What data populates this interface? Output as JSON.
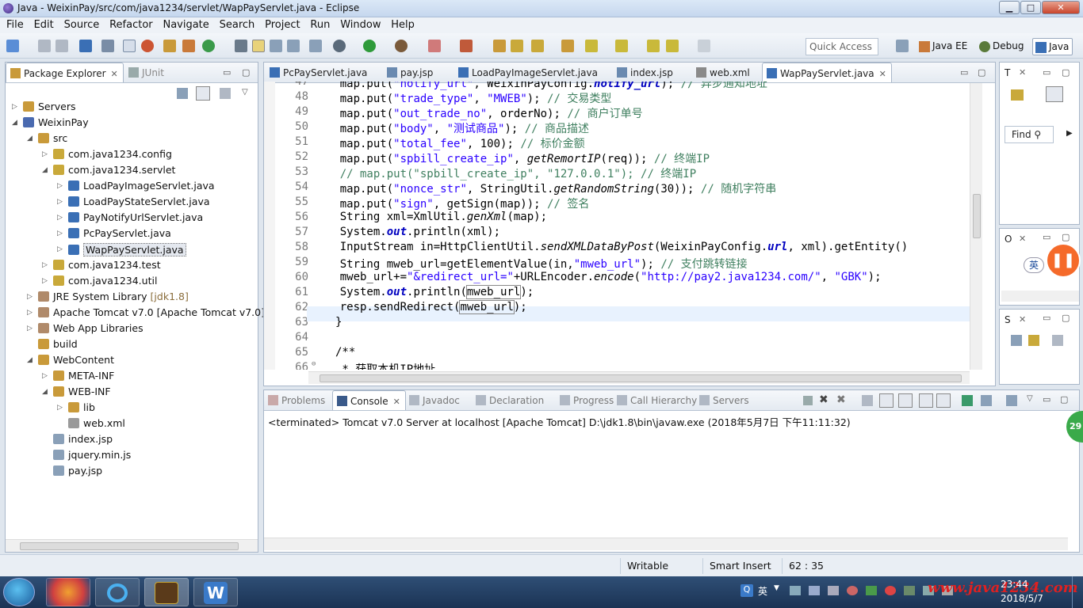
{
  "window": {
    "title": "Java - WeixinPay/src/com/java1234/servlet/WapPayServlet.java - Eclipse",
    "min": "▁",
    "max": "□",
    "close": "✕"
  },
  "menu": [
    "File",
    "Edit",
    "Source",
    "Refactor",
    "Navigate",
    "Search",
    "Project",
    "Run",
    "Window",
    "Help"
  ],
  "toolbar": {
    "quick_access_placeholder": "Quick Access",
    "perspectives": [
      "Java EE",
      "Debug",
      "Java"
    ]
  },
  "package_explorer": {
    "tabs": [
      "Package Explorer",
      "JUnit"
    ],
    "items": [
      {
        "label": "Servers",
        "depth": 0,
        "arrow": "▷"
      },
      {
        "label": "WeixinPay",
        "depth": 0,
        "arrow": "◢"
      },
      {
        "label": "src",
        "depth": 1,
        "arrow": "◢"
      },
      {
        "label": "com.java1234.config",
        "depth": 2,
        "arrow": "▷"
      },
      {
        "label": "com.java1234.servlet",
        "depth": 2,
        "arrow": "◢"
      },
      {
        "label": "LoadPayImageServlet.java",
        "depth": 3,
        "arrow": "▷"
      },
      {
        "label": "LoadPayStateServlet.java",
        "depth": 3,
        "arrow": "▷"
      },
      {
        "label": "PayNotifyUrlServlet.java",
        "depth": 3,
        "arrow": "▷"
      },
      {
        "label": "PcPayServlet.java",
        "depth": 3,
        "arrow": "▷"
      },
      {
        "label": "WapPayServlet.java",
        "depth": 3,
        "arrow": "▷"
      },
      {
        "label": "com.java1234.test",
        "depth": 2,
        "arrow": "▷"
      },
      {
        "label": "com.java1234.util",
        "depth": 2,
        "arrow": "▷"
      },
      {
        "label": "JRE System Library",
        "sub": "[jdk1.8]",
        "depth": 1,
        "arrow": "▷"
      },
      {
        "label": "Apache Tomcat v7.0 [Apache Tomcat v7.0]",
        "depth": 1,
        "arrow": "▷"
      },
      {
        "label": "Web App Libraries",
        "depth": 1,
        "arrow": "▷"
      },
      {
        "label": "build",
        "depth": 1,
        "arrow": ""
      },
      {
        "label": "WebContent",
        "depth": 1,
        "arrow": "◢"
      },
      {
        "label": "META-INF",
        "depth": 2,
        "arrow": "▷"
      },
      {
        "label": "WEB-INF",
        "depth": 2,
        "arrow": "◢"
      },
      {
        "label": "lib",
        "depth": 3,
        "arrow": "▷"
      },
      {
        "label": "web.xml",
        "depth": 3,
        "arrow": ""
      },
      {
        "label": "index.jsp",
        "depth": 2,
        "arrow": ""
      },
      {
        "label": "jquery.min.js",
        "depth": 2,
        "arrow": ""
      },
      {
        "label": "pay.jsp",
        "depth": 2,
        "arrow": ""
      }
    ]
  },
  "editor": {
    "tabs": [
      "PcPayServlet.java",
      "pay.jsp",
      "LoadPayImageServlet.java",
      "index.jsp",
      "web.xml",
      "WapPayServlet.java"
    ],
    "lines": [
      {
        "n": "47",
        "html": "map.put(\"notify_url\", WeixinPayConfig.notify_url); // 异步通知地址"
      },
      {
        "n": "48"
      },
      {
        "n": "49"
      },
      {
        "n": "50"
      },
      {
        "n": "51"
      },
      {
        "n": "52"
      },
      {
        "n": "53"
      },
      {
        "n": "54"
      },
      {
        "n": "55"
      },
      {
        "n": "56"
      },
      {
        "n": "57"
      },
      {
        "n": "58"
      },
      {
        "n": "59"
      },
      {
        "n": "60"
      },
      {
        "n": "61"
      },
      {
        "n": "62"
      },
      {
        "n": "63"
      },
      {
        "n": "64"
      },
      {
        "n": "65"
      },
      {
        "n": "66"
      }
    ]
  },
  "right_panels": {
    "t_label": "T",
    "o_label": "O",
    "s_label": "S",
    "find_placeholder": "Find",
    "ime": "英"
  },
  "console": {
    "tabs": [
      "Problems",
      "Console",
      "Javadoc",
      "Declaration",
      "Progress",
      "Call Hierarchy",
      "Servers"
    ],
    "status": "<terminated> Tomcat v7.0 Server at localhost [Apache Tomcat] D:\\jdk1.8\\bin\\javaw.exe (2018年5月7日 下午11:11:32)"
  },
  "statusbar": {
    "writable": "Writable",
    "insert": "Smart Insert",
    "position": "62 : 35"
  },
  "taskbar": {
    "time": "23:44",
    "date": "2018/5/7",
    "ime": "英",
    "watermark": "www.java1234.com",
    "badge": "29"
  },
  "colors": {
    "accent": "#3875d7",
    "keyword": "#7f0055",
    "string": "#2a00ff",
    "comment": "#3f7f5f"
  }
}
